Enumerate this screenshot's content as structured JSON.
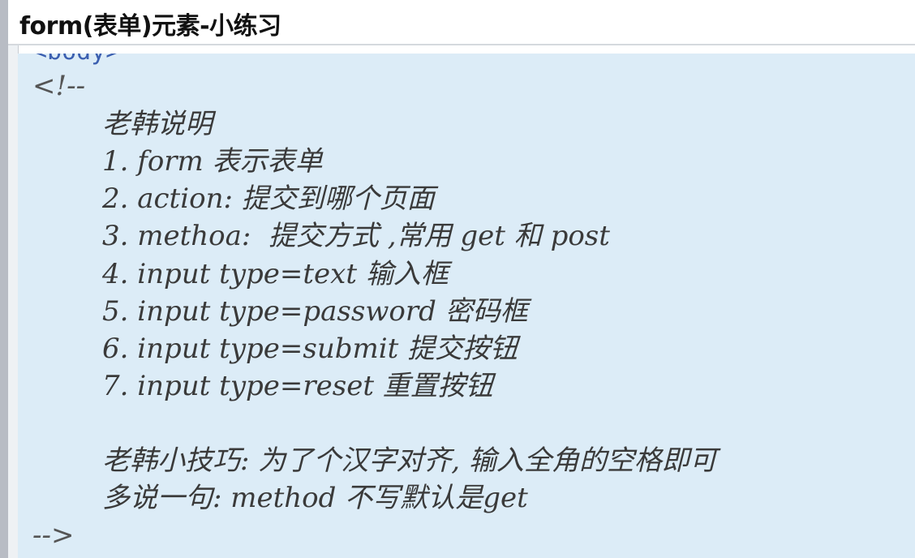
{
  "window": {
    "title": "form(表单)元素-小练习"
  },
  "editor": {
    "cut_line": "<body>",
    "lines": [
      "<!--",
      "老韩说明",
      "1. form 表示表单",
      "2. action: 提交到哪个页面",
      "3. methoa:  提交方式 ,常用 get 和 post",
      "4. input type=text 输入框",
      "5. input type=password 密码框",
      "6. input type=submit 提交按钮",
      "7. input type=reset 重置按钮",
      "",
      "老韩小技巧: 为了个汉字对齐, 输入全角的空格即可",
      "多说一句: method 不写默认是get",
      "-->"
    ]
  },
  "colors": {
    "editor_background": "#dcecf7",
    "comment_text": "#3a3a3a",
    "tag_text": "#3b5fb0"
  }
}
